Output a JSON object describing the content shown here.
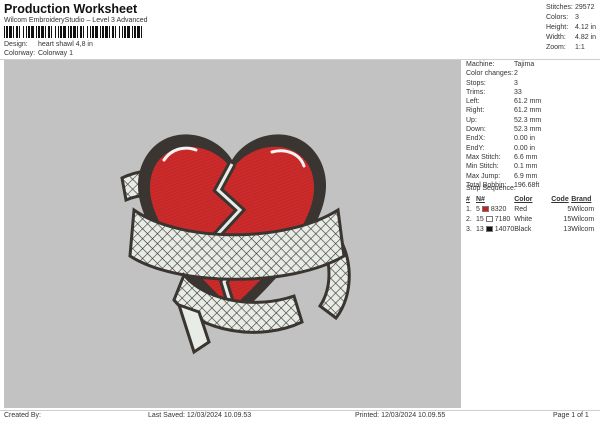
{
  "header": {
    "title": "Production Worksheet",
    "subtitle": "Wilcom EmbroideryStudio – Level 3 Advanced"
  },
  "design": {
    "label": "Design:",
    "value": "heart shawl 4,8 in"
  },
  "colorway": {
    "label": "Colorway:",
    "value": "Colorway 1"
  },
  "stats": [
    {
      "label": "Stitches:",
      "value": "29572"
    },
    {
      "label": "Colors:",
      "value": "3"
    },
    {
      "label": "Height:",
      "value": "4.12 in"
    },
    {
      "label": "Width:",
      "value": "4.82 in"
    },
    {
      "label": "Zoom:",
      "value": "1:1"
    }
  ],
  "machine_info": [
    {
      "label": "Machine:",
      "value": "Tajima"
    },
    {
      "label": "Color changes:",
      "value": "2"
    },
    {
      "label": "Stops:",
      "value": "3"
    },
    {
      "label": "Trims:",
      "value": "33"
    },
    {
      "label": "Left:",
      "value": "61.2 mm"
    },
    {
      "label": "Right:",
      "value": "61.2 mm"
    },
    {
      "label": "Up:",
      "value": "52.3 mm"
    },
    {
      "label": "Down:",
      "value": "52.3 mm"
    },
    {
      "label": "EndX:",
      "value": "0.00 in"
    },
    {
      "label": "EndY:",
      "value": "0.00 in"
    },
    {
      "label": "Max Stitch:",
      "value": "6.6 mm"
    },
    {
      "label": "Min Stitch:",
      "value": "0.1 mm"
    },
    {
      "label": "Max Jump:",
      "value": "6.9 mm"
    },
    {
      "label": "Total Bobbin:",
      "value": "196.68ft"
    }
  ],
  "stop_sequence": {
    "title": "Stop Sequence:",
    "headers": {
      "index": "#",
      "n": "N#",
      "color": "Color",
      "code": "Code",
      "brand": "Brand"
    },
    "rows": [
      {
        "index": "1.",
        "n": "5",
        "swatch": "#cc1f1f",
        "stitches": "8320",
        "color": "Red",
        "code": "5",
        "brand": "Wilcom"
      },
      {
        "index": "2.",
        "n": "15",
        "swatch": "#ffffff",
        "stitches": "7180",
        "color": "White",
        "code": "15",
        "brand": "Wilcom"
      },
      {
        "index": "3.",
        "n": "13",
        "swatch": "#111111",
        "stitches": "14070",
        "color": "Black",
        "code": "13",
        "brand": "Wilcom"
      }
    ]
  },
  "footer": {
    "created": "Created By:",
    "saved": "Last Saved: 12/03/2024 10.09.53",
    "printed": "Printed: 12/03/2024 10.09.55",
    "page": "Page 1 of 1"
  },
  "colors": {
    "canvas_bg": "#c2c2c2",
    "heart_red": "#cc2b2b",
    "outline_dark": "#3a3530",
    "ribbon_light": "#e8ece6"
  }
}
